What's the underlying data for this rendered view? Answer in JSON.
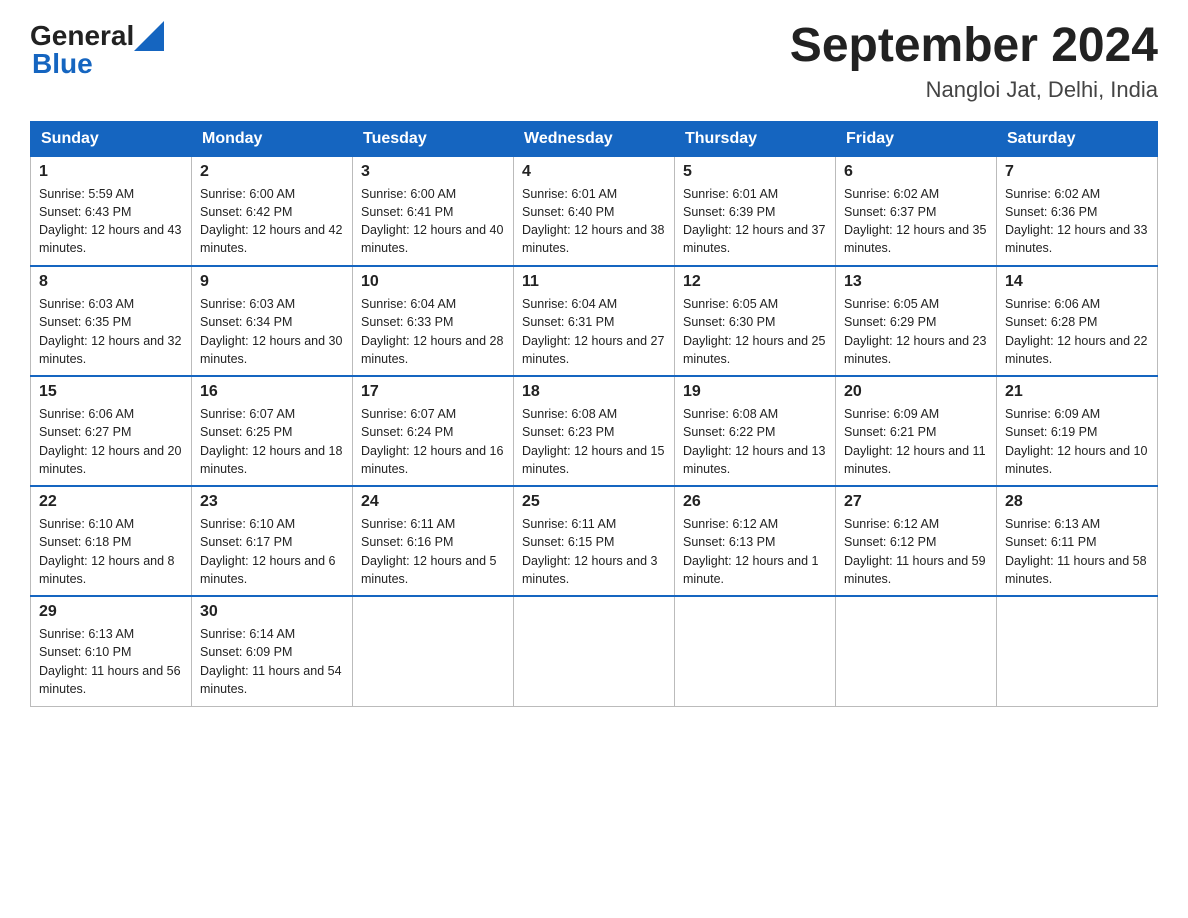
{
  "header": {
    "logo_general": "General",
    "logo_blue": "Blue",
    "month": "September 2024",
    "location": "Nangloi Jat, Delhi, India"
  },
  "weekdays": [
    "Sunday",
    "Monday",
    "Tuesday",
    "Wednesday",
    "Thursday",
    "Friday",
    "Saturday"
  ],
  "weeks": [
    [
      {
        "day": "1",
        "sunrise": "5:59 AM",
        "sunset": "6:43 PM",
        "daylight": "12 hours and 43 minutes."
      },
      {
        "day": "2",
        "sunrise": "6:00 AM",
        "sunset": "6:42 PM",
        "daylight": "12 hours and 42 minutes."
      },
      {
        "day": "3",
        "sunrise": "6:00 AM",
        "sunset": "6:41 PM",
        "daylight": "12 hours and 40 minutes."
      },
      {
        "day": "4",
        "sunrise": "6:01 AM",
        "sunset": "6:40 PM",
        "daylight": "12 hours and 38 minutes."
      },
      {
        "day": "5",
        "sunrise": "6:01 AM",
        "sunset": "6:39 PM",
        "daylight": "12 hours and 37 minutes."
      },
      {
        "day": "6",
        "sunrise": "6:02 AM",
        "sunset": "6:37 PM",
        "daylight": "12 hours and 35 minutes."
      },
      {
        "day": "7",
        "sunrise": "6:02 AM",
        "sunset": "6:36 PM",
        "daylight": "12 hours and 33 minutes."
      }
    ],
    [
      {
        "day": "8",
        "sunrise": "6:03 AM",
        "sunset": "6:35 PM",
        "daylight": "12 hours and 32 minutes."
      },
      {
        "day": "9",
        "sunrise": "6:03 AM",
        "sunset": "6:34 PM",
        "daylight": "12 hours and 30 minutes."
      },
      {
        "day": "10",
        "sunrise": "6:04 AM",
        "sunset": "6:33 PM",
        "daylight": "12 hours and 28 minutes."
      },
      {
        "day": "11",
        "sunrise": "6:04 AM",
        "sunset": "6:31 PM",
        "daylight": "12 hours and 27 minutes."
      },
      {
        "day": "12",
        "sunrise": "6:05 AM",
        "sunset": "6:30 PM",
        "daylight": "12 hours and 25 minutes."
      },
      {
        "day": "13",
        "sunrise": "6:05 AM",
        "sunset": "6:29 PM",
        "daylight": "12 hours and 23 minutes."
      },
      {
        "day": "14",
        "sunrise": "6:06 AM",
        "sunset": "6:28 PM",
        "daylight": "12 hours and 22 minutes."
      }
    ],
    [
      {
        "day": "15",
        "sunrise": "6:06 AM",
        "sunset": "6:27 PM",
        "daylight": "12 hours and 20 minutes."
      },
      {
        "day": "16",
        "sunrise": "6:07 AM",
        "sunset": "6:25 PM",
        "daylight": "12 hours and 18 minutes."
      },
      {
        "day": "17",
        "sunrise": "6:07 AM",
        "sunset": "6:24 PM",
        "daylight": "12 hours and 16 minutes."
      },
      {
        "day": "18",
        "sunrise": "6:08 AM",
        "sunset": "6:23 PM",
        "daylight": "12 hours and 15 minutes."
      },
      {
        "day": "19",
        "sunrise": "6:08 AM",
        "sunset": "6:22 PM",
        "daylight": "12 hours and 13 minutes."
      },
      {
        "day": "20",
        "sunrise": "6:09 AM",
        "sunset": "6:21 PM",
        "daylight": "12 hours and 11 minutes."
      },
      {
        "day": "21",
        "sunrise": "6:09 AM",
        "sunset": "6:19 PM",
        "daylight": "12 hours and 10 minutes."
      }
    ],
    [
      {
        "day": "22",
        "sunrise": "6:10 AM",
        "sunset": "6:18 PM",
        "daylight": "12 hours and 8 minutes."
      },
      {
        "day": "23",
        "sunrise": "6:10 AM",
        "sunset": "6:17 PM",
        "daylight": "12 hours and 6 minutes."
      },
      {
        "day": "24",
        "sunrise": "6:11 AM",
        "sunset": "6:16 PM",
        "daylight": "12 hours and 5 minutes."
      },
      {
        "day": "25",
        "sunrise": "6:11 AM",
        "sunset": "6:15 PM",
        "daylight": "12 hours and 3 minutes."
      },
      {
        "day": "26",
        "sunrise": "6:12 AM",
        "sunset": "6:13 PM",
        "daylight": "12 hours and 1 minute."
      },
      {
        "day": "27",
        "sunrise": "6:12 AM",
        "sunset": "6:12 PM",
        "daylight": "11 hours and 59 minutes."
      },
      {
        "day": "28",
        "sunrise": "6:13 AM",
        "sunset": "6:11 PM",
        "daylight": "11 hours and 58 minutes."
      }
    ],
    [
      {
        "day": "29",
        "sunrise": "6:13 AM",
        "sunset": "6:10 PM",
        "daylight": "11 hours and 56 minutes."
      },
      {
        "day": "30",
        "sunrise": "6:14 AM",
        "sunset": "6:09 PM",
        "daylight": "11 hours and 54 minutes."
      },
      null,
      null,
      null,
      null,
      null
    ]
  ],
  "labels": {
    "sunrise_prefix": "Sunrise: ",
    "sunset_prefix": "Sunset: ",
    "daylight_prefix": "Daylight: "
  }
}
